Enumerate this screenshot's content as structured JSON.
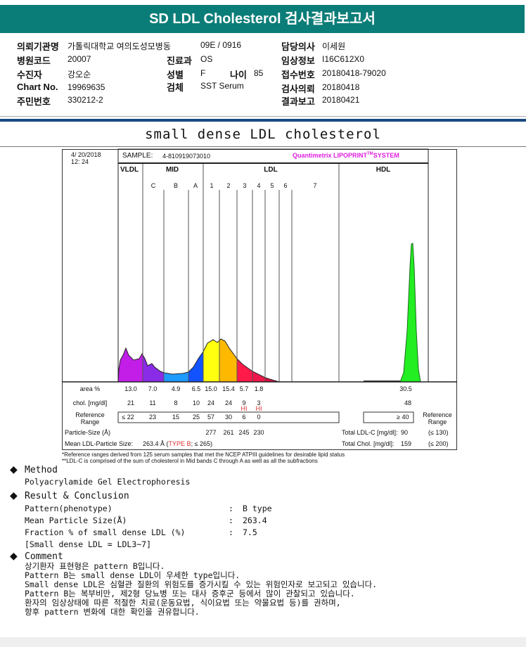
{
  "title": "SD LDL Cholesterol 검사결과보고서",
  "info": {
    "institution_label": "의뢰기관명",
    "institution": "가톨릭대학교 여의도성모병동",
    "ward": "09E / 0916",
    "doctor_label": "담당의사",
    "doctor": "이세원",
    "hospital_code_label": "병원코드",
    "hospital_code": "20007",
    "dept_label": "진료과",
    "dept": "OS",
    "clinical_label": "임상정보",
    "clinical": "I16C612X0",
    "patient_label": "수진자",
    "patient": "강오순",
    "sex_label": "성별",
    "sex": "F",
    "age_label": "나이",
    "age": "85",
    "receipt_label": "접수번호",
    "receipt": "20180418-79020",
    "chart_label": "Chart No.",
    "chart": "19969635",
    "specimen_label": "검체",
    "specimen": "SST Serum",
    "request_label": "검사의뢰",
    "request": "20180418",
    "id_label": "주민번호",
    "id": "330212-2",
    "report_label": "결과보고",
    "report": "20180421"
  },
  "section_title": "small dense LDL cholesterol",
  "report": {
    "date": "4/ 20/2018",
    "time": "12: 24",
    "sample_label": "SAMPLE:",
    "sample": "4-810919073010",
    "brand": "Quantimetrix LIPOPRINT",
    "brand_tm": "TM",
    "brand_sys": "SYSTEM",
    "groups": {
      "vldl": "VLDL",
      "mid": "MID",
      "ldl": "LDL",
      "hdl": "HDL"
    },
    "bands": [
      "C",
      "B",
      "A",
      "1",
      "2",
      "3",
      "4",
      "5",
      "6",
      "7"
    ],
    "area_label": "area %",
    "chol_label": "chol. [mg/dl]",
    "ref_label1": "Reference",
    "ref_label2": "Range",
    "area": [
      "13.0",
      "7.0",
      "4.9",
      "6.5",
      "15.0",
      "15.4",
      "5.7",
      "1.8"
    ],
    "chol": [
      "21",
      "11",
      "8",
      "10",
      "24",
      "24",
      "9",
      "3"
    ],
    "flags": [
      "",
      "",
      "",
      "",
      "",
      "",
      "HI",
      "HI"
    ],
    "ref": [
      "≤ 22",
      "23",
      "15",
      "25",
      "57",
      "30",
      "6",
      "0"
    ],
    "hdl_area": "30.5",
    "hdl_chol": "48",
    "hdl_ref": "≥ 40",
    "particle_label": "Particle-Size (Å)",
    "particle": [
      "277",
      "261",
      "245",
      "230"
    ],
    "mean_label": "Mean LDL-Particle Size:",
    "mean_value": "263.4 Å",
    "mean_open": "(",
    "mean_type": "TYPE B",
    "mean_rest": "; ≤ 265)",
    "total_ldl_label": "Total LDL-C [mg/dl]:",
    "total_ldl": "90",
    "total_ldl_ref": "(≤ 130)",
    "total_chol_label": "Total Chol. [mg/dl]:",
    "total_chol": "159",
    "total_chol_ref": "(≤ 200)",
    "foot1": "*Reference ranges derived from 125 serum samples that met the NCEP ATPIII guidelines for desirable lipid status",
    "foot2": "**LDL-C is comprised of the sum of cholesterol in Mid bands C through A as well as all the subfractions",
    "colors": {
      "vldl": "#c21ee8",
      "c": "#8a2be8",
      "b": "#1e9bff",
      "a": "#1352ff",
      "l1": "#ffff10",
      "l2": "#ffb800",
      "l3": "#ff1a4a",
      "l4": "#f0184a",
      "l5": "#d81040",
      "hdl": "#22ee22"
    }
  },
  "method": {
    "title": "Method",
    "text": "Polyacrylamide Gel Electrophoresis"
  },
  "result": {
    "title": "Result & Conclusion",
    "rows": [
      {
        "label": "Pattern(phenotype)",
        "value": "B type"
      },
      {
        "label": "Mean Particle Size(Å)",
        "value": "263.4"
      },
      {
        "label": "Fraction % of small dense LDL (%)",
        "value": "7.5"
      }
    ],
    "colon": ":",
    "note": "[Small dense LDL = LDL3~7]"
  },
  "comment": {
    "title": "Comment",
    "lines": [
      "상기환자 표현형은 pattern B입니다.",
      "Pattern B는 small dense LDL이 우세한 type입니다.",
      "Small dense LDL은 심혈관 질환의 위험도를 증가시킬 수 있는 위험인자로 보고되고 있습니다.",
      "Pattern B는 복부비만, 제2형 당뇨병 또는 대사 증후군 등에서 많이 관찰되고 있습니다.",
      "환자의 임상상태에 따른 적절한 치료(운동요법, 식이요법 또는 약물요법 등)를 권하며,",
      "향후 pattern 변화에 대한 확인을 권유합니다."
    ]
  }
}
